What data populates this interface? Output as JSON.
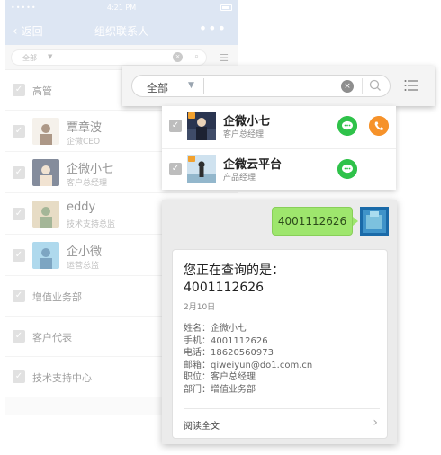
{
  "status_bar": {
    "signal": "•••••",
    "time": "4:21 PM"
  },
  "nav": {
    "back_label": "返回",
    "title": "组织联系人",
    "more": "•••"
  },
  "bg_search": {
    "filter": "全部"
  },
  "bg_list": {
    "groups_top": [
      {
        "label": "高管"
      }
    ],
    "people": [
      {
        "name": "覃章波",
        "position": "企微CEO"
      },
      {
        "name": "企微小七",
        "position": "客户总经理"
      },
      {
        "name": "eddy",
        "position": "技术支持总监"
      },
      {
        "name": "企小微",
        "position": "运营总监"
      }
    ],
    "groups_bottom": [
      {
        "label": "增值业务部"
      },
      {
        "label": "客户代表"
      },
      {
        "label": "技术支持中心"
      }
    ]
  },
  "search_overlay": {
    "filter": "全部"
  },
  "results": [
    {
      "name": "企微小七",
      "position": "客户总经理"
    },
    {
      "name": "企微云平台",
      "position": "产品经理"
    }
  ],
  "chat": {
    "sent_message": "4001112626",
    "reply": {
      "heading": "您正在查询的是：",
      "number": "4001112626",
      "date": "2月10日",
      "fields": [
        {
          "key": "姓名：",
          "value": "企微小七"
        },
        {
          "key": "手机：",
          "value": "4001112626"
        },
        {
          "key": "电话：",
          "value": "18620560973"
        },
        {
          "key": "邮箱：",
          "value": "qiweiyun@do1.com.cn"
        },
        {
          "key": "职位：",
          "value": "客户总经理"
        },
        {
          "key": "部门：",
          "value": "增值业务部"
        }
      ],
      "read_more": "阅读全文"
    }
  }
}
